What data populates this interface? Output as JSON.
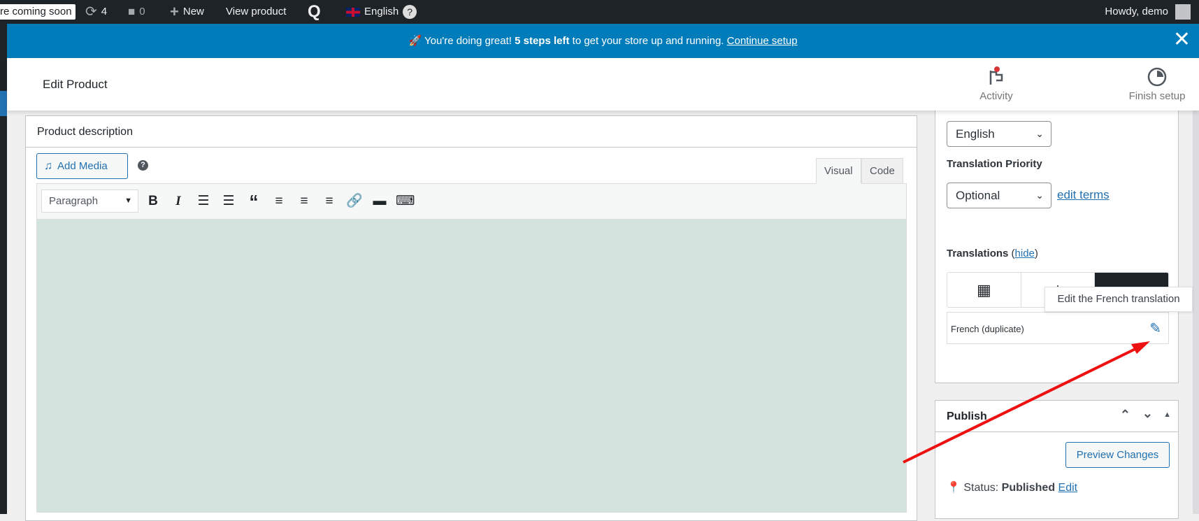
{
  "adminbar": {
    "coming_soon": "re coming soon",
    "updates": "4",
    "comments": "0",
    "new": "New",
    "view_product": "View product",
    "language": "English",
    "help": "?",
    "howdy": "Howdy, demo"
  },
  "banner": {
    "prefix": "You're doing great! ",
    "bold": "5 steps left",
    "middle": " to get your store up and running. ",
    "link": "Continue setup"
  },
  "header": {
    "title": "Edit Product",
    "activity": "Activity",
    "finish_setup": "Finish setup"
  },
  "editor": {
    "title": "Product description",
    "add_media": "Add Media",
    "help": "?",
    "tab_visual": "Visual",
    "tab_code": "Code",
    "format": "Paragraph",
    "bold": "B",
    "italic": "I"
  },
  "language_box": {
    "language": "English",
    "priority_label": "Translation Priority",
    "priority": "Optional",
    "edit_terms": "edit terms",
    "translations_label": "Translations",
    "hide": "hide",
    "french_row": "French (duplicate)",
    "tooltip": "Edit the French translation"
  },
  "publish": {
    "title": "Publish",
    "preview": "Preview Changes",
    "status_label": "Status:",
    "status": "Published",
    "edit": "Edit"
  },
  "colors": {
    "accent": "#2271b1",
    "banner": "#007cba",
    "editor_bg": "#d2e4dd",
    "arrow": "#ee1111"
  }
}
